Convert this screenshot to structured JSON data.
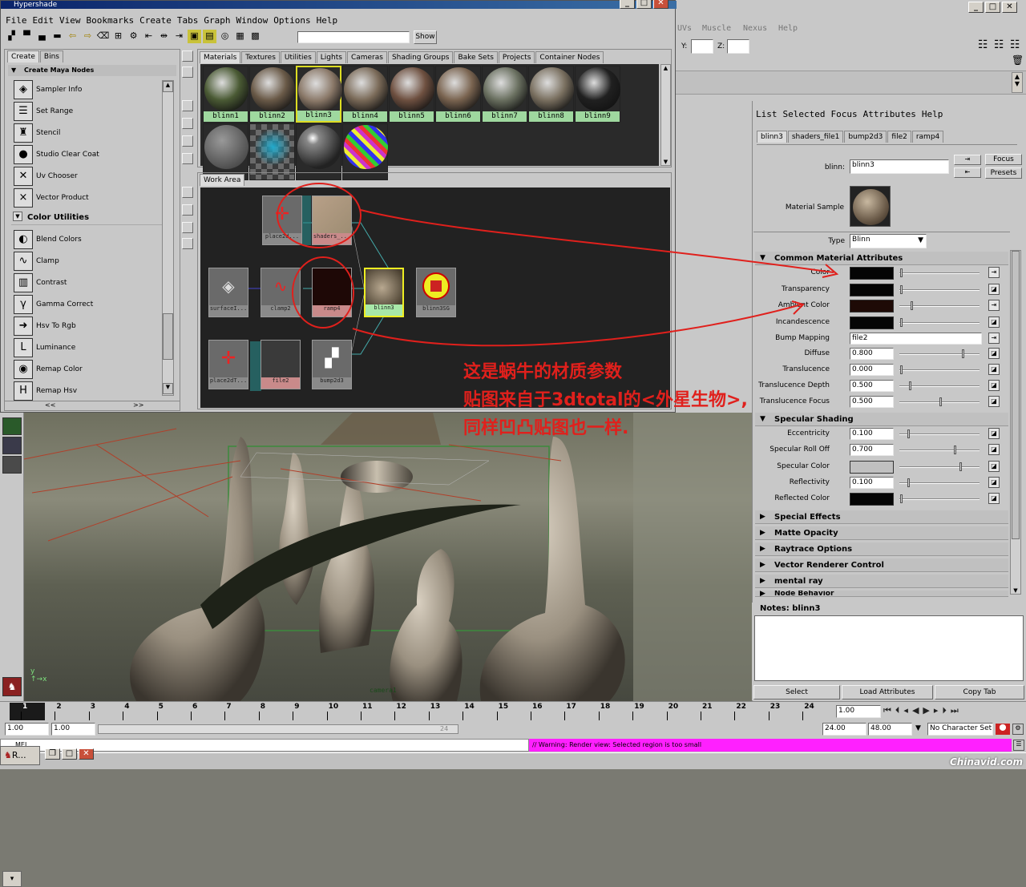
{
  "hypershade": {
    "title": "Hypershade",
    "menu": [
      "File",
      "Edit",
      "View",
      "Bookmarks",
      "Create",
      "Tabs",
      "Graph",
      "Window",
      "Options",
      "Help"
    ],
    "show_label": "Show",
    "left_tabs": [
      "Create",
      "Bins"
    ],
    "create_header": "Create Maya Nodes",
    "nodes_top": [
      {
        "label": "Sampler Info",
        "icon": "sampler-info-icon",
        "glyph": "◈"
      },
      {
        "label": "Set Range",
        "icon": "set-range-icon",
        "glyph": "☰"
      },
      {
        "label": "Stencil",
        "icon": "stencil-icon",
        "glyph": "♜"
      },
      {
        "label": "Studio Clear Coat",
        "icon": "studio-clear-coat-icon",
        "glyph": "●"
      },
      {
        "label": "Uv Chooser",
        "icon": "uv-chooser-icon",
        "glyph": "✕"
      },
      {
        "label": "Vector Product",
        "icon": "vector-product-icon",
        "glyph": "×"
      }
    ],
    "color_utilities_header": "Color Utilities",
    "nodes_color": [
      {
        "label": "Blend Colors",
        "icon": "blend-colors-icon",
        "glyph": "◐"
      },
      {
        "label": "Clamp",
        "icon": "clamp-icon",
        "glyph": "∿"
      },
      {
        "label": "Contrast",
        "icon": "contrast-icon",
        "glyph": "▥"
      },
      {
        "label": "Gamma Correct",
        "icon": "gamma-correct-icon",
        "glyph": "γ"
      },
      {
        "label": "Hsv To Rgb",
        "icon": "hsv-to-rgb-icon",
        "glyph": "➜"
      },
      {
        "label": "Luminance",
        "icon": "luminance-icon",
        "glyph": "L"
      },
      {
        "label": "Remap Color",
        "icon": "remap-color-icon",
        "glyph": "◉"
      },
      {
        "label": "Remap Hsv",
        "icon": "remap-hsv-icon",
        "glyph": "H"
      }
    ],
    "scroll_prev": "<<",
    "scroll_next": ">>",
    "material_tabs": [
      "Materials",
      "Textures",
      "Utilities",
      "Lights",
      "Cameras",
      "Shading Groups",
      "Bake Sets",
      "Projects",
      "Container Nodes"
    ],
    "swatches": [
      {
        "label": "blinn1",
        "color": "#4a5a34"
      },
      {
        "label": "blinn2",
        "color": "#6a5a48"
      },
      {
        "label": "blinn3",
        "color": "#8a7868"
      },
      {
        "label": "blinn4",
        "color": "#7a6a58"
      },
      {
        "label": "blinn5",
        "color": "#6e5040"
      },
      {
        "label": "blinn6",
        "color": "#7a6450"
      },
      {
        "label": "blinn7",
        "color": "#6a7060"
      },
      {
        "label": "blinn8",
        "color": "#7a7060"
      },
      {
        "label": "blinn9",
        "color": "#202020"
      }
    ],
    "work_area_tab": "Work Area",
    "work_nodes": [
      {
        "label": "place2d..."
      },
      {
        "label": "shaders_..."
      },
      {
        "label": "surfaceI..."
      },
      {
        "label": "clamp2"
      },
      {
        "label": "ramp4"
      },
      {
        "label": "blinn3"
      },
      {
        "label": "blinn3SG"
      },
      {
        "label": "place2dT..."
      },
      {
        "label": "file2"
      },
      {
        "label": "bump2d3"
      }
    ]
  },
  "annotation": {
    "line1": "这是蜗牛的材质参数",
    "line2": "贴图来自于3dtotal的<外星生物>,",
    "line3": "同样凹凸贴图也一样."
  },
  "main_menu": [
    "UVs",
    "Muscle",
    "Nexus",
    "Help"
  ],
  "coord": {
    "y_label": "Y:",
    "z_label": "Z:"
  },
  "attribute_editor": {
    "menu": [
      "List",
      "Selected",
      "Focus",
      "Attributes",
      "Help"
    ],
    "tabs": [
      "blinn3",
      "shaders_file1",
      "bump2d3",
      "file2",
      "ramp4"
    ],
    "node_label": "blinn:",
    "node_value": "blinn3",
    "focus_label": "Focus",
    "presets_label": "Presets",
    "material_sample_label": "Material Sample",
    "type_label": "Type",
    "type_value": "Blinn",
    "common_header": "Common Material Attributes",
    "common": [
      {
        "label": "Color",
        "color": "#050505"
      },
      {
        "label": "Transparency",
        "color": "#050505"
      },
      {
        "label": "Ambient Color",
        "color": "#1e0a06"
      },
      {
        "label": "Incandescence",
        "color": "#050505"
      }
    ],
    "bump_label": "Bump Mapping",
    "bump_value": "file2",
    "numeric": [
      {
        "label": "Diffuse",
        "value": "0.800"
      },
      {
        "label": "Translucence",
        "value": "0.000"
      },
      {
        "label": "Translucence Depth",
        "value": "0.500"
      },
      {
        "label": "Translucence Focus",
        "value": "0.500"
      }
    ],
    "specular_header": "Specular Shading",
    "specular": [
      {
        "label": "Eccentricity",
        "value": "0.100"
      },
      {
        "label": "Specular Roll Off",
        "value": "0.700"
      },
      {
        "label": "Specular Color",
        "value": ""
      },
      {
        "label": "Reflectivity",
        "value": "0.100"
      },
      {
        "label": "Reflected Color",
        "value": ""
      }
    ],
    "collapsed_sections": [
      "Special Effects",
      "Matte Opacity",
      "Raytrace Options",
      "Vector Renderer Control",
      "mental ray",
      "Node Behavior"
    ],
    "notes_label": "Notes:  blinn3",
    "buttons": [
      "Select",
      "Load Attributes",
      "Copy Tab"
    ]
  },
  "timeline": {
    "ticks": [
      "1",
      "2",
      "3",
      "4",
      "5",
      "6",
      "7",
      "8",
      "9",
      "10",
      "11",
      "12",
      "13",
      "14",
      "15",
      "16",
      "17",
      "18",
      "19",
      "20",
      "21",
      "22",
      "23",
      "24"
    ],
    "current_frame": "1.00",
    "range_start": "1.00",
    "range_start2": "1.00",
    "range_mid": "24",
    "range_end": "24.00",
    "range_end2": "48.00",
    "character_set": "No Character Set"
  },
  "command_line": {
    "mel_label": "MEL",
    "warning": "// Warning: Render view: Selected region is too small"
  },
  "taskbar": {
    "app": "R..."
  },
  "watermark": "Chinavid.com",
  "viewport": {
    "camera_label": "camera1"
  }
}
